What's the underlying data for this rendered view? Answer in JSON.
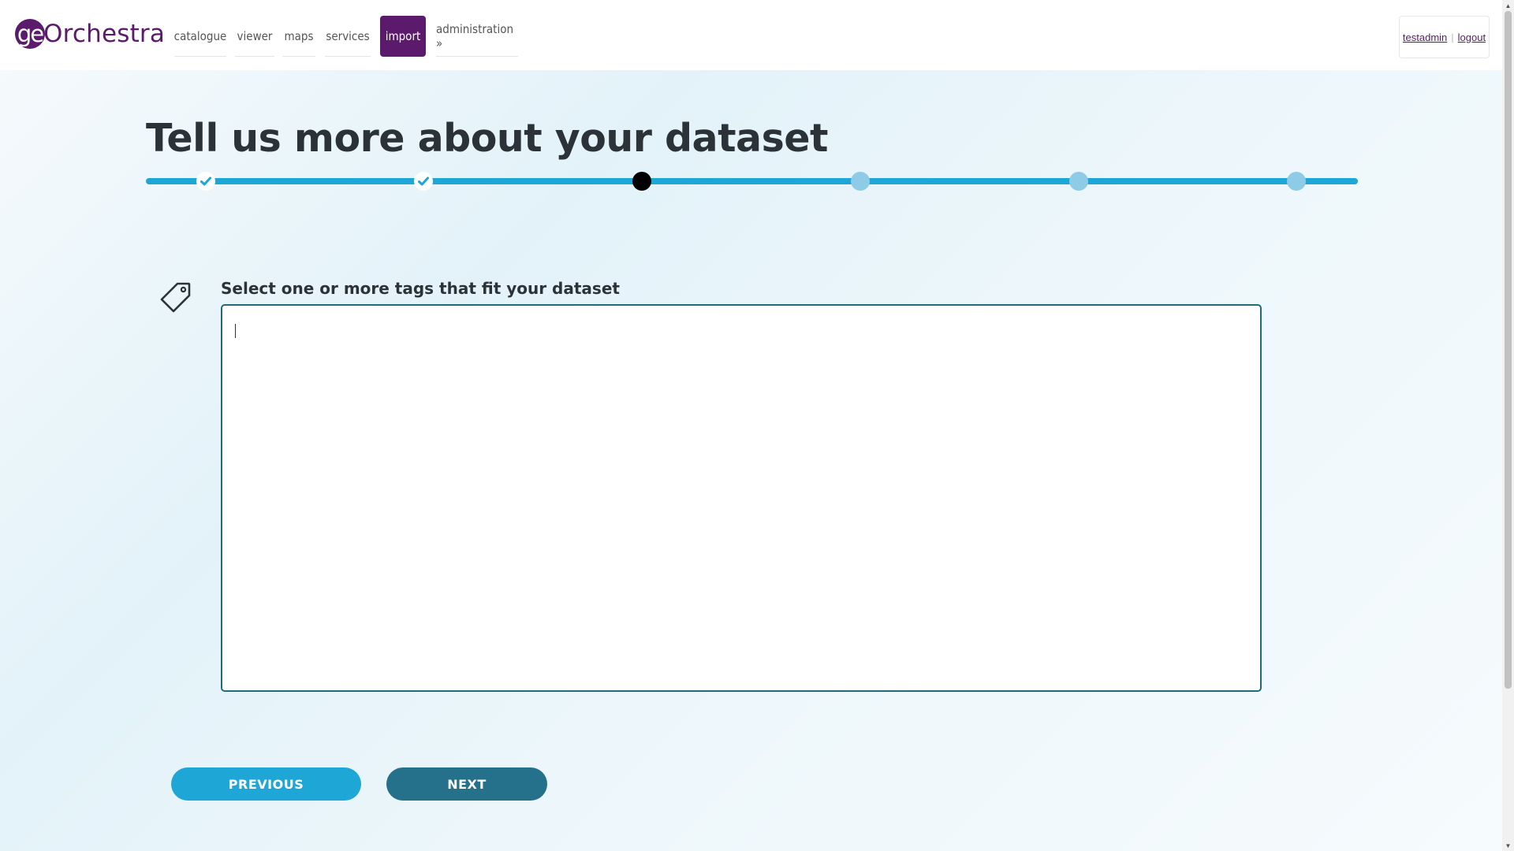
{
  "header": {
    "logo": {
      "prefix": "ge",
      "rest": "Orchestra"
    },
    "nav": [
      {
        "label": "catalogue",
        "active": false
      },
      {
        "label": "viewer",
        "active": false
      },
      {
        "label": "maps",
        "active": false
      },
      {
        "label": "services",
        "active": false
      },
      {
        "label": "import",
        "active": true
      },
      {
        "label": "administration »",
        "active": false
      }
    ],
    "user": {
      "username": "testadmin",
      "separator": "|",
      "logout": "logout"
    }
  },
  "main": {
    "title": "Tell us more about your dataset",
    "steps": [
      {
        "status": "done",
        "icon": "check-icon"
      },
      {
        "status": "done",
        "icon": "check-icon"
      },
      {
        "status": "current"
      },
      {
        "status": "todo"
      },
      {
        "status": "todo"
      },
      {
        "status": "todo"
      }
    ],
    "tags_field": {
      "label": "Select one or more tags that fit your dataset",
      "icon": "tag-icon",
      "value": ""
    },
    "buttons": {
      "previous": "PREVIOUS",
      "next": "NEXT"
    }
  },
  "colors": {
    "brand": "#5b1a6b",
    "progress": "#1ea7d6",
    "step_todo": "#8dcbe6",
    "next_button": "#25708a",
    "input_border": "#1f6b78"
  }
}
